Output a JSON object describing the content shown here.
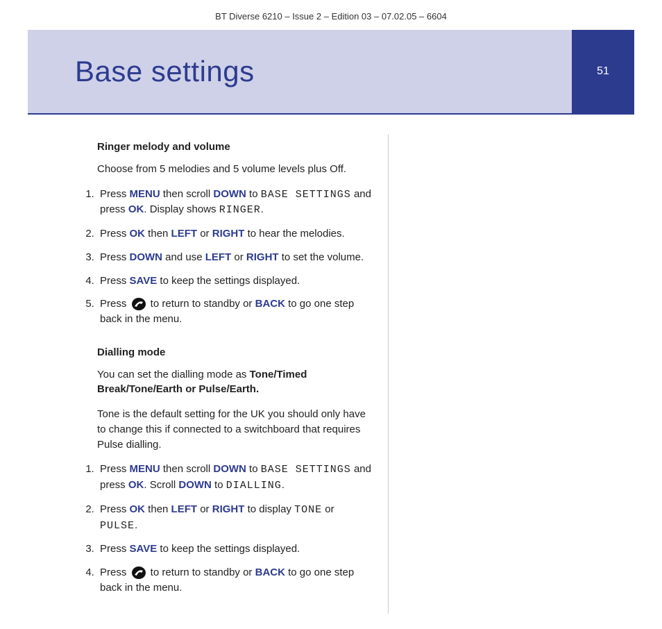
{
  "meta": {
    "header": "BT Diverse 6210 – Issue 2 – Edition 03 – 07.02.05 – 6604"
  },
  "banner": {
    "title": "Base settings",
    "page_number": "51"
  },
  "section1": {
    "heading": "Ringer melody and volume",
    "intro": "Choose from 5 melodies and 5 volume levels plus Off.",
    "s1_a": "Press ",
    "s1_menu": "MENU",
    "s1_b": " then scroll ",
    "s1_down": "DOWN",
    "s1_c": " to ",
    "s1_lcd1": "BASE SETTINGS",
    "s1_d": " and press ",
    "s1_ok": "OK",
    "s1_e": ". Display shows ",
    "s1_lcd2": "RINGER",
    "s1_f": ".",
    "s2_a": "Press ",
    "s2_ok": "OK",
    "s2_b": " then ",
    "s2_left": "LEFT",
    "s2_c": " or ",
    "s2_right": "RIGHT",
    "s2_d": " to hear the melodies.",
    "s3_a": "Press ",
    "s3_down": "DOWN",
    "s3_b": " and use ",
    "s3_left": "LEFT",
    "s3_c": " or ",
    "s3_right": "RIGHT",
    "s3_d": " to set the volume.",
    "s4_a": "Press ",
    "s4_save": "SAVE",
    "s4_b": " to keep the settings displayed.",
    "s5_a": "Press ",
    "s5_b": " to return to standby or ",
    "s5_back": "BACK",
    "s5_c": " to go one step back in the menu."
  },
  "section2": {
    "heading": "Dialling mode",
    "intro_a": "You can set the dialling mode as ",
    "intro_bold": "Tone/Timed Break/Tone/Earth or Pulse/Earth.",
    "intro2": "Tone is the default setting for the UK you should only have to change this if connected to a switchboard that requires Pulse dialling.",
    "s1_a": "Press ",
    "s1_menu": "MENU",
    "s1_b": " then scroll ",
    "s1_down": "DOWN",
    "s1_c": " to ",
    "s1_lcd1": "BASE SETTINGS",
    "s1_d": " and press ",
    "s1_ok": "OK",
    "s1_e": ". Scroll ",
    "s1_down2": "DOWN",
    "s1_f": " to ",
    "s1_lcd2": "DIALLING",
    "s1_g": ".",
    "s2_a": "Press ",
    "s2_ok": "OK",
    "s2_b": " then ",
    "s2_left": "LEFT",
    "s2_c": " or ",
    "s2_right": "RIGHT",
    "s2_d": " to display ",
    "s2_lcd1": "TONE",
    "s2_e": " or ",
    "s2_lcd2": "PULSE",
    "s2_f": ".",
    "s3_a": "Press ",
    "s3_save": "SAVE",
    "s3_b": " to keep the settings displayed.",
    "s4_a": "Press ",
    "s4_b": " to return to standby or ",
    "s4_back": "BACK",
    "s4_c": " to go one step back in the menu."
  }
}
